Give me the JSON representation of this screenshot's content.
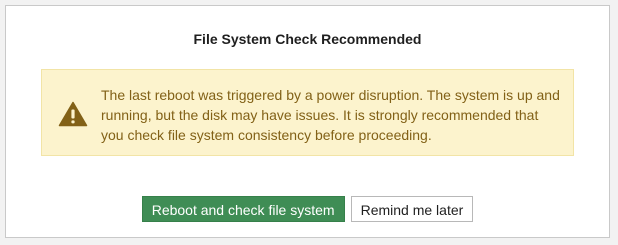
{
  "dialog": {
    "title": "File System Check Recommended",
    "warning": {
      "icon": "warning-triangle-icon",
      "message": "The last reboot was triggered by a power disruption. The system is up and running, but the disk may have issues. It is strongly recommended that you check file system consistency before proceeding."
    },
    "buttons": {
      "primary_label": "Reboot and check file system",
      "secondary_label": "Remind me later"
    }
  },
  "colors": {
    "warning_background": "#fcf3cd",
    "warning_text": "#826117",
    "primary_button": "#3f8d55"
  }
}
